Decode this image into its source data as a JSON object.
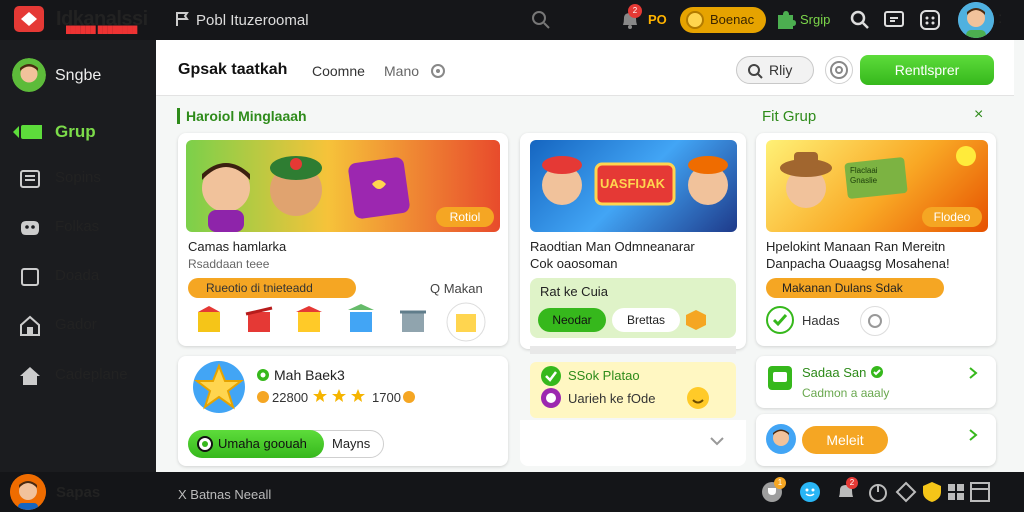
{
  "topbar": {
    "brand": "Idkanalssi",
    "brand_sub": "██████ ████████",
    "nav_text": "Pobl  Ituzeroomal",
    "badge_count": "2",
    "coin_count": "PO",
    "coin_button": "Boenac",
    "gem_label": "Srgip",
    "menu_glyph": ":"
  },
  "sidebar": {
    "user_name": "Sngbe",
    "items": [
      {
        "label": "Grup",
        "icon": "folder-icon",
        "active": true
      },
      {
        "label": "Sopins",
        "icon": "list-icon"
      },
      {
        "label": "Folkas",
        "icon": "gamepad-icon"
      },
      {
        "label": "Doada",
        "icon": "square-icon"
      },
      {
        "label": "Gador",
        "icon": "home-icon"
      },
      {
        "label": "Cadeplane",
        "icon": "house-icon"
      }
    ]
  },
  "header": {
    "title": "Gpsak taatkah",
    "tab1": "Coomne",
    "tab2": "Mano",
    "search_label": "Rliy",
    "primary_button": "Rentlsprer"
  },
  "section_left": {
    "title": "Haroiol Minglaaah"
  },
  "section_right": {
    "title": "Fit Grup",
    "close": "×"
  },
  "card1": {
    "banner_tag": "Rotiol",
    "title": "Camas hamlarka",
    "subtitle": "Rsaddaan teee",
    "tag": "Rueotio di tnieteadd",
    "link": "Q Makan"
  },
  "card2": {
    "banner_text": "UASFIJAK",
    "title": "Raodtian Man Odmneanarar",
    "subtitle": "Cok oaosoman",
    "box_title": "Rat ke Cuia",
    "pill_active": "Neodar",
    "pill_inactive": "Brettas",
    "list_item_1": "SSok Platao",
    "list_item_2": "Uarieh ke fOde"
  },
  "card3": {
    "banner_text": "Flaclaai Gnaslie",
    "banner_tag": "Flodeo",
    "title": "Hpelokint Manaan Ran Mereitn",
    "subtitle": "Danpacha  Ouaagsg Mosahena!",
    "tag": "Makanan Dulans Sdak",
    "pill": "Hadas"
  },
  "card4": {
    "title": "Mah Baek3",
    "stat1": "22800",
    "stat2": "1700",
    "button_primary": "Umaha goouah",
    "button_secondary": "Mayns"
  },
  "card5": {
    "title": "Sadaa San",
    "subtitle": "Cadmon a aaaly"
  },
  "card6": {
    "button": "Meleit"
  },
  "bottombar": {
    "user": "Sapas",
    "status": "X Batnas Neeall",
    "badge1": "1",
    "badge2": "2"
  },
  "colors": {
    "accent_green": "#36b81c",
    "accent_orange": "#f5a623",
    "dark_bg": "#1b1c1f",
    "red": "#e53935"
  }
}
